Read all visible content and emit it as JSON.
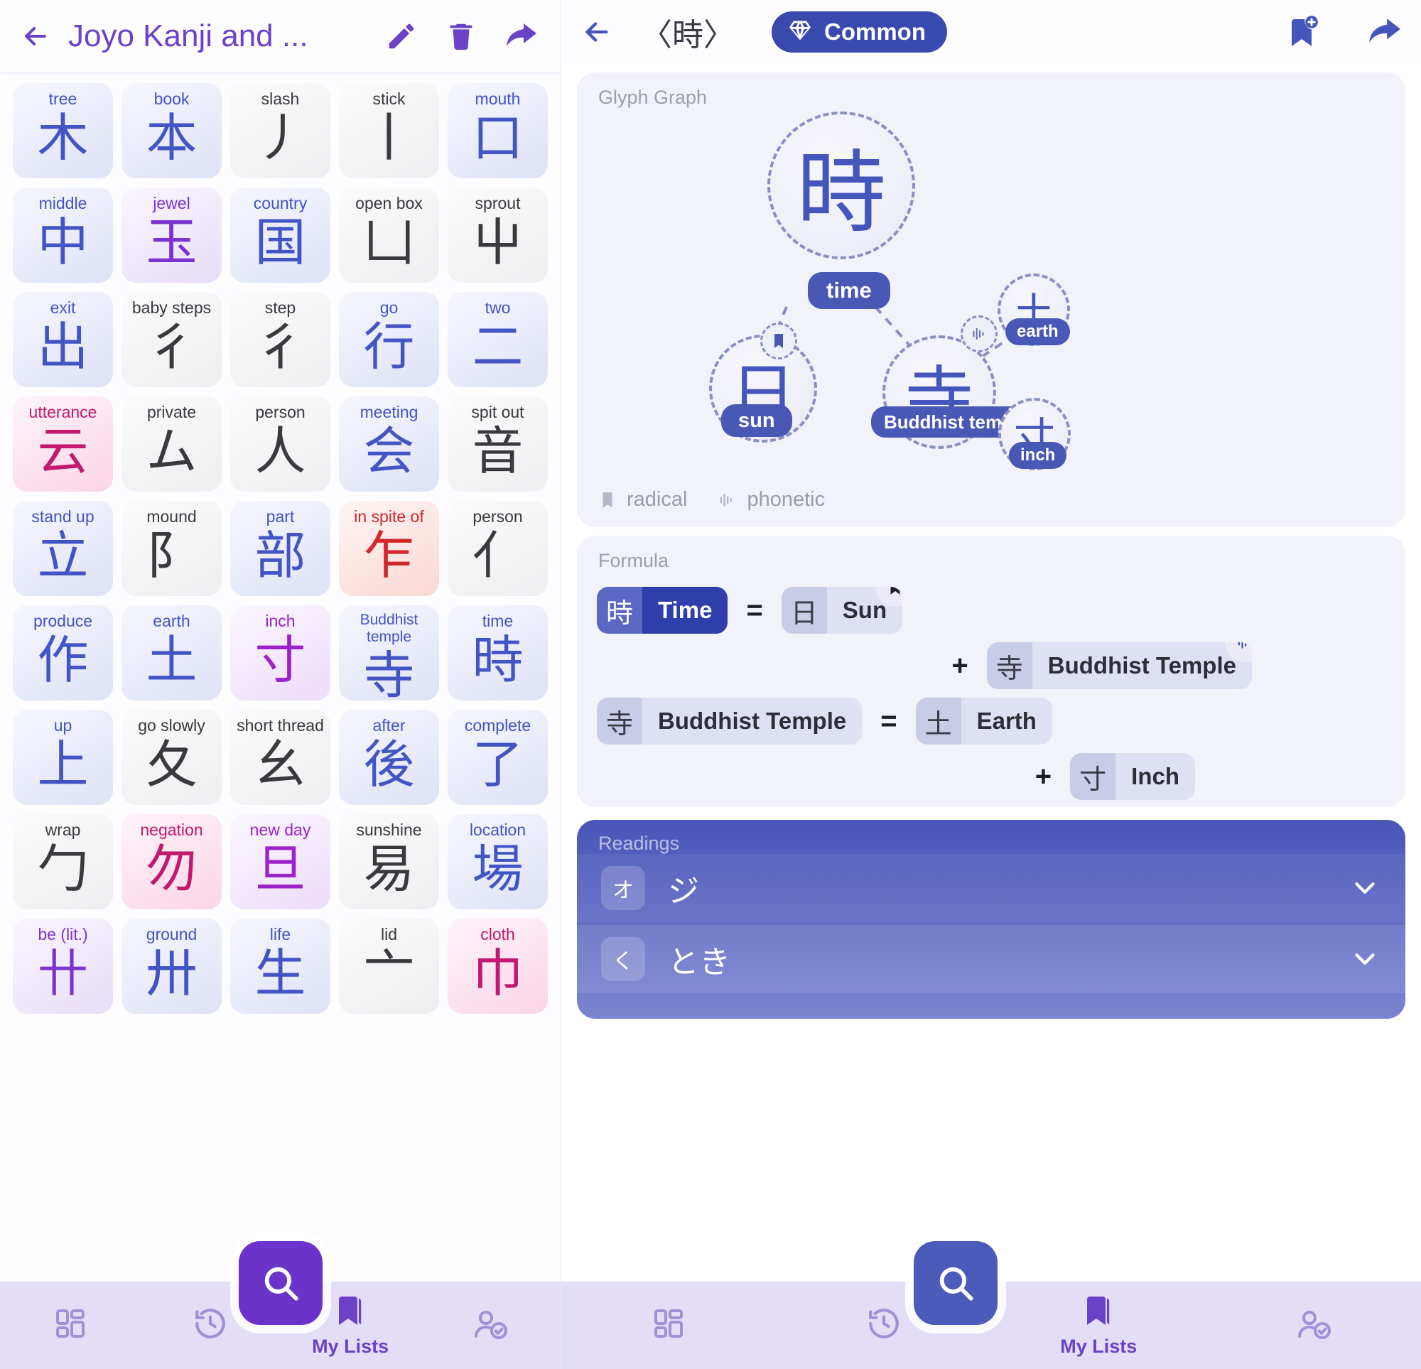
{
  "left": {
    "header": {
      "back_icon": "back-arrow-icon",
      "title": "Joyo Kanji and ...",
      "edit_icon": "pencil-icon",
      "delete_icon": "trash-icon",
      "share_icon": "share-icon"
    },
    "kanji_cards": [
      {
        "label": "tree",
        "char": "木",
        "theme": "t-blue"
      },
      {
        "label": "book",
        "char": "本",
        "theme": "t-blue"
      },
      {
        "label": "slash",
        "char": "丿",
        "theme": "t-gray"
      },
      {
        "label": "stick",
        "char": "丨",
        "theme": "t-gray"
      },
      {
        "label": "mouth",
        "char": "口",
        "theme": "t-blue"
      },
      {
        "label": "middle",
        "char": "中",
        "theme": "t-blue"
      },
      {
        "label": "jewel",
        "char": "玉",
        "theme": "t-purple"
      },
      {
        "label": "country",
        "char": "国",
        "theme": "t-blue"
      },
      {
        "label": "open box",
        "char": "凵",
        "theme": "t-gray"
      },
      {
        "label": "sprout",
        "char": "屮",
        "theme": "t-gray"
      },
      {
        "label": "exit",
        "char": "出",
        "theme": "t-blue"
      },
      {
        "label": "baby steps",
        "char": "彳",
        "theme": "t-gray"
      },
      {
        "label": "step",
        "char": "彳",
        "theme": "t-gray"
      },
      {
        "label": "go",
        "char": "行",
        "theme": "t-blue"
      },
      {
        "label": "two",
        "char": "二",
        "theme": "t-blue"
      },
      {
        "label": "utterance",
        "char": "云",
        "theme": "t-pink"
      },
      {
        "label": "private",
        "char": "ム",
        "theme": "t-gray"
      },
      {
        "label": "person",
        "char": "人",
        "theme": "t-gray"
      },
      {
        "label": "meeting",
        "char": "会",
        "theme": "t-blue"
      },
      {
        "label": "spit out",
        "char": "音",
        "theme": "t-gray"
      },
      {
        "label": "stand up",
        "char": "立",
        "theme": "t-blue"
      },
      {
        "label": "mound",
        "char": "阝",
        "theme": "t-gray"
      },
      {
        "label": "part",
        "char": "部",
        "theme": "t-blue"
      },
      {
        "label": "in spite of",
        "char": "乍",
        "theme": "t-red"
      },
      {
        "label": "person",
        "char": "亻",
        "theme": "t-gray"
      },
      {
        "label": "produce",
        "char": "作",
        "theme": "t-blue"
      },
      {
        "label": "earth",
        "char": "土",
        "theme": "t-blue"
      },
      {
        "label": "inch",
        "char": "寸",
        "theme": "t-violet"
      },
      {
        "label": "Buddhist temple",
        "char": "寺",
        "theme": "t-blue",
        "wrap": true
      },
      {
        "label": "time",
        "char": "時",
        "theme": "t-blue"
      },
      {
        "label": "up",
        "char": "上",
        "theme": "t-blue"
      },
      {
        "label": "go slowly",
        "char": "夂",
        "theme": "t-gray"
      },
      {
        "label": "short thread",
        "char": "幺",
        "theme": "t-gray"
      },
      {
        "label": "after",
        "char": "後",
        "theme": "t-blue"
      },
      {
        "label": "complete",
        "char": "了",
        "theme": "t-blue"
      },
      {
        "label": "wrap",
        "char": "勹",
        "theme": "t-gray"
      },
      {
        "label": "negation",
        "char": "勿",
        "theme": "t-pink"
      },
      {
        "label": "new day",
        "char": "旦",
        "theme": "t-violet"
      },
      {
        "label": "sunshine",
        "char": "易",
        "theme": "t-gray"
      },
      {
        "label": "location",
        "char": "場",
        "theme": "t-blue"
      },
      {
        "label": "be (lit.)",
        "char": "卄",
        "theme": "t-purple"
      },
      {
        "label": "ground",
        "char": "卅",
        "theme": "t-blue"
      },
      {
        "label": "life",
        "char": "生",
        "theme": "t-blue"
      },
      {
        "label": "lid",
        "char": "亠",
        "theme": "t-gray"
      },
      {
        "label": "cloth",
        "char": "巾",
        "theme": "t-pink"
      }
    ],
    "bottom_nav": {
      "items": [
        {
          "icon": "dashboard-grid-icon",
          "label": ""
        },
        {
          "icon": "history-clock-icon",
          "label": ""
        },
        {
          "icon": "bookmark-icon",
          "label": "My Lists",
          "active": true
        },
        {
          "icon": "account-check-icon",
          "label": ""
        }
      ],
      "fab_icon": "search-icon"
    }
  },
  "right": {
    "header": {
      "back_icon": "back-arrow-icon",
      "kanji_title": "〈時〉",
      "badge": {
        "icon": "diamond-icon",
        "label": "Common"
      },
      "bookmark_add_icon": "bookmark-add-icon",
      "share_icon": "share-icon"
    },
    "glyph_graph": {
      "title": "Glyph Graph",
      "nodes": [
        {
          "char": "時",
          "label": "time"
        },
        {
          "char": "日",
          "label": "sun"
        },
        {
          "char": "寺",
          "label": "Buddhist temple"
        },
        {
          "char": "土",
          "label": "earth"
        },
        {
          "char": "寸",
          "label": "inch"
        }
      ],
      "legend": [
        {
          "icon": "radical-icon",
          "label": "radical"
        },
        {
          "icon": "phonetic-icon",
          "label": "phonetic"
        }
      ]
    },
    "formula": {
      "title": "Formula",
      "rows": [
        {
          "left": {
            "char": "時",
            "label": "Time",
            "style": "hl"
          },
          "op": "=",
          "right": {
            "char": "日",
            "label": "Sun",
            "style": "norm",
            "badge": "radical-icon"
          }
        },
        {
          "op": "+",
          "right": {
            "char": "寺",
            "label": "Buddhist Temple",
            "style": "norm",
            "badge": "phonetic-icon"
          }
        },
        {
          "left": {
            "char": "寺",
            "label": "Buddhist Temple",
            "style": "norm"
          },
          "op": "=",
          "right": {
            "char": "土",
            "label": "Earth",
            "style": "norm"
          }
        },
        {
          "op": "+",
          "right": {
            "char": "寸",
            "label": "Inch",
            "style": "norm"
          }
        }
      ]
    },
    "readings": {
      "title": "Readings",
      "rows": [
        {
          "tag": "オ",
          "reading": "ジ",
          "chevron": "chevron-down-icon"
        },
        {
          "tag": "く",
          "reading": "とき",
          "chevron": "chevron-down-icon"
        }
      ]
    },
    "bottom_nav": {
      "items": [
        {
          "icon": "dashboard-grid-icon",
          "label": ""
        },
        {
          "icon": "history-clock-icon",
          "label": ""
        },
        {
          "icon": "bookmark-icon",
          "label": "My Lists",
          "active": true
        },
        {
          "icon": "account-check-icon",
          "label": ""
        }
      ],
      "fab_icon": "search-icon"
    }
  },
  "colors": {
    "left_accent": "#6a42c8",
    "right_accent": "#4655bb",
    "badge_bg": "#3a49ad",
    "readings_bg": "#4a56b8",
    "nav_bg": "#e3ddf6"
  }
}
